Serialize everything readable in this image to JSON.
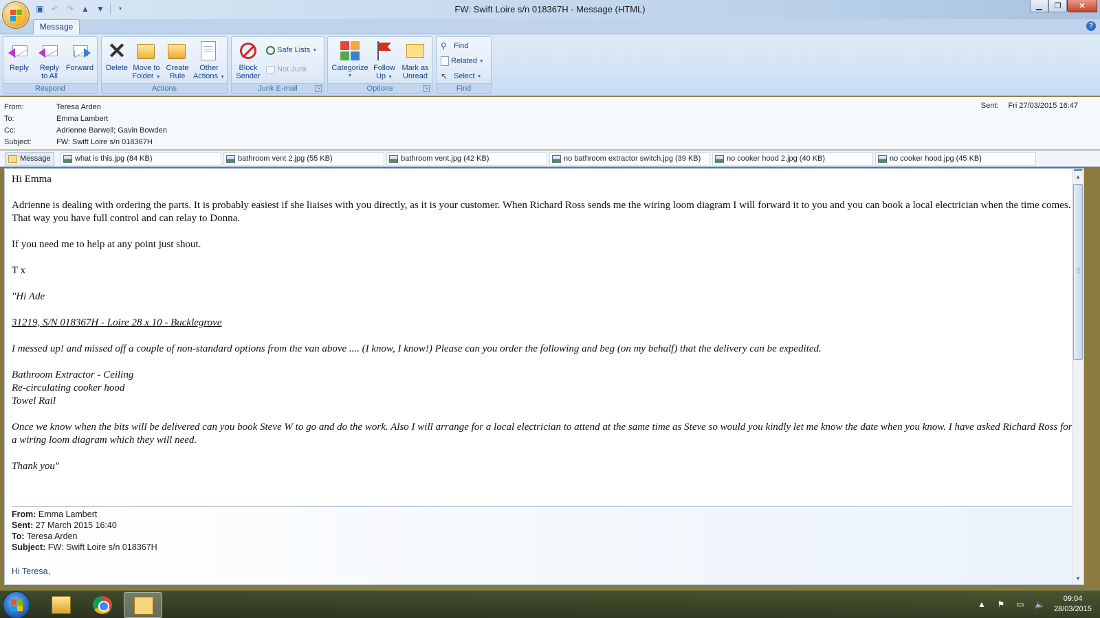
{
  "window": {
    "title": "FW: Swift Loire s/n 018367H - Message (HTML)",
    "controls": [
      "minimize",
      "restore",
      "close"
    ]
  },
  "quick_access": [
    "save-icon",
    "undo-icon",
    "redo-icon",
    "previous-icon",
    "next-icon",
    "customize-icon"
  ],
  "ribbon": {
    "active_tab": "Message",
    "groups": {
      "respond": {
        "label": "Respond",
        "reply": "Reply",
        "reply_all_1": "Reply",
        "reply_all_2": "to All",
        "forward": "Forward"
      },
      "actions": {
        "label": "Actions",
        "delete": "Delete",
        "move_1": "Move to",
        "move_2": "Folder",
        "create_1": "Create",
        "create_2": "Rule",
        "other_1": "Other",
        "other_2": "Actions"
      },
      "junk": {
        "label": "Junk E-mail",
        "block_1": "Block",
        "block_2": "Sender",
        "safe_lists": "Safe Lists",
        "not_junk": "Not Junk"
      },
      "options": {
        "label": "Options",
        "categorize": "Categorize",
        "follow_1": "Follow",
        "follow_2": "Up",
        "mark_1": "Mark as",
        "mark_2": "Unread"
      },
      "find": {
        "label": "Find",
        "find": "Find",
        "related": "Related",
        "select": "Select"
      }
    }
  },
  "headers": {
    "from_label": "From:",
    "from": "Teresa Arden",
    "to_label": "To:",
    "to": "Emma Lambert",
    "cc_label": "Cc:",
    "cc": "Adrienne Barwell; Gavin Bowden",
    "subject_label": "Subject:",
    "subject": "FW: Swift Loire s/n 018367H",
    "sent_label": "Sent:",
    "sent": "Fri 27/03/2015 16:47"
  },
  "attachments": [
    "Message",
    "what is this.jpg (84 KB)",
    "bathroom vent 2.jpg (55 KB)",
    "bathroom vent.jpg (42 KB)",
    "no bathroom extractor switch.jpg (39 KB)",
    "no cooker hood 2.jpg (40 KB)",
    "no cooker hood.jpg (45 KB)"
  ],
  "body": {
    "greeting": "Hi Emma",
    "p1": "Adrienne is dealing with ordering the parts.  It is probably easiest if she liaises with you directly, as it is your customer.  When Richard Ross sends me the wiring loom diagram I will forward it to you and you can book a local electrician when the time comes.  That way you have full control and can relay to Donna.",
    "p2": "If you need me to help at any point just shout.",
    "signoff": "T x",
    "quote_greeting": "\"Hi Ade",
    "quote_ref": "31219, S/N 018367H - Loire 28 x 10 - Bucklegrove",
    "quote_p1": "I messed up! and missed off a couple of non-standard options from the van above .... (I know, I know!)  Please can you order the following and beg (on my behalf) that the delivery can be expedited.",
    "items": [
      "Bathroom Extractor - Ceiling",
      "Re-circulating cooker hood",
      "Towel Rail"
    ],
    "quote_p2": "Once we know when the bits will be delivered can you book Steve W to go and do the work.  Also I will arrange for a local electrician to attend at the same time as Steve so would you kindly let me know the date when you know.  I have asked Richard Ross for a wiring loom diagram which they will need.",
    "quote_end": "Thank you\""
  },
  "forwarded": {
    "from_label": "From:",
    "from": "Emma Lambert",
    "sent_label": "Sent:",
    "sent": "27 March 2015 16:40",
    "to_label": "To:",
    "to": "Teresa Arden",
    "subject_label": "Subject:",
    "subject": "FW: Swift Loire s/n 018367H",
    "greeting": "Hi Teresa,"
  },
  "taskbar": {
    "apps": [
      "windows-explorer",
      "google-chrome",
      "outlook-message"
    ],
    "time": "09:04",
    "date": "28/03/2015"
  },
  "colors": {
    "ribbon_text": "#15428b",
    "accent": "#2e6ec8"
  }
}
